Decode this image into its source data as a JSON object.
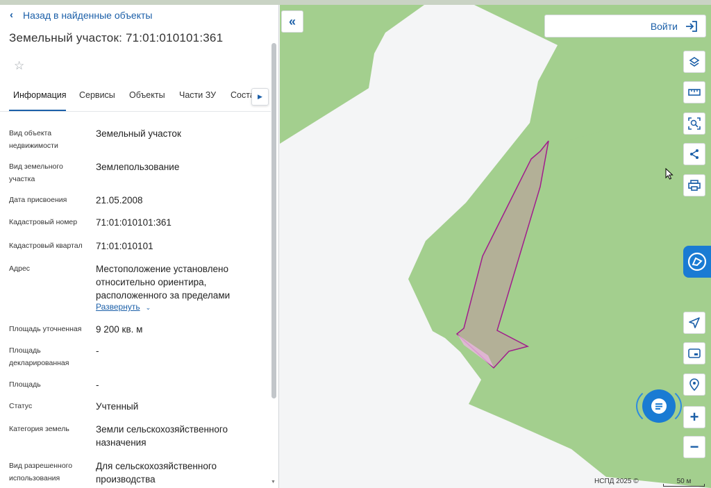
{
  "panel": {
    "back_label": "Назад в найденные объекты",
    "title": "Земельный участок: 71:01:010101:361",
    "tabs": [
      "Информация",
      "Сервисы",
      "Объекты",
      "Части ЗУ",
      "Соста"
    ],
    "active_tab": "Информация",
    "rows": [
      {
        "label": "Вид объекта недвижимости",
        "value": "Земельный участок"
      },
      {
        "label": "Вид земельного участка",
        "value": "Землепользование"
      },
      {
        "label": "Дата присвоения",
        "value": "21.05.2008"
      },
      {
        "label": "Кадастровый номер",
        "value": "71:01:010101:361"
      },
      {
        "label": "Кадастровый квартал",
        "value": "71:01:010101"
      },
      {
        "label": "Адрес",
        "value": "Местоположение установлено относительно ориентира, расположенного за пределами"
      },
      {
        "label": "Площадь уточненная",
        "value": "9 200 кв. м"
      },
      {
        "label": "Площадь декларированная",
        "value": "-"
      },
      {
        "label": "Площадь",
        "value": "-"
      },
      {
        "label": "Статус",
        "value": "Учтенный"
      },
      {
        "label": "Категория земель",
        "value": "Земли сельскохозяйственного назначения"
      },
      {
        "label": "Вид разрешенного использования",
        "value": "Для сельскохозяйственного производства"
      }
    ],
    "expand_label": "Развернуть"
  },
  "map": {
    "login_label": "Войти",
    "attribution": "НСПД 2025 ©",
    "scale_label": "50 м",
    "tools": [
      "layers-icon",
      "ruler-icon",
      "area-select-icon",
      "share-icon",
      "print-icon",
      "locate-icon",
      "minimap-icon",
      "geo-search-icon",
      "zoom-in-icon",
      "zoom-out-icon"
    ],
    "colors": {
      "forest": "#a3cf8e",
      "parcel_stroke": "#a01d8c",
      "parcel_fill": "#b7a89a",
      "accent": "#1b5fa8"
    }
  }
}
